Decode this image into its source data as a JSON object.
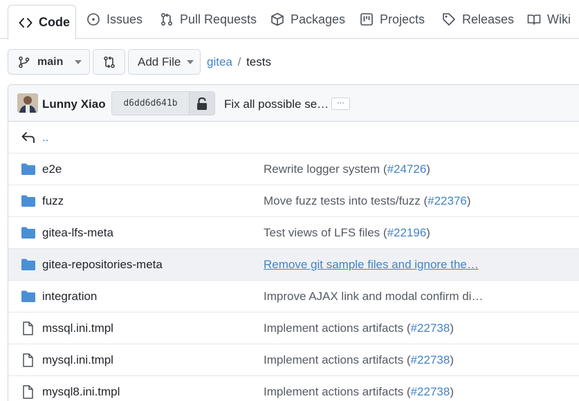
{
  "tabs": [
    {
      "label": "Code",
      "icon": "code-icon",
      "active": true
    },
    {
      "label": "Issues",
      "icon": "issue-icon"
    },
    {
      "label": "Pull Requests",
      "icon": "pull-request-icon"
    },
    {
      "label": "Packages",
      "icon": "package-icon"
    },
    {
      "label": "Projects",
      "icon": "project-icon"
    },
    {
      "label": "Releases",
      "icon": "tag-icon"
    },
    {
      "label": "Wiki",
      "icon": "book-icon"
    }
  ],
  "toolbar": {
    "branch": "main",
    "add_file": "Add File",
    "breadcrumb": {
      "repo": "gitea",
      "sep": "/",
      "path": "tests"
    }
  },
  "commit": {
    "author": "Lunny Xiao",
    "sha": "d6dd6d641b",
    "message": "Fix all possible se…",
    "ellipsis": "···"
  },
  "parent_dir": "..",
  "files": [
    {
      "name": "e2e",
      "type": "folder",
      "message": "Rewrite logger system (",
      "pr": "#24726",
      "tail": ")"
    },
    {
      "name": "fuzz",
      "type": "folder",
      "message": "Move fuzz tests into tests/fuzz (",
      "pr": "#22376",
      "tail": ")"
    },
    {
      "name": "gitea-lfs-meta",
      "type": "folder",
      "message": "Test views of LFS files (",
      "pr": "#22196",
      "tail": ")"
    },
    {
      "name": "gitea-repositories-meta",
      "type": "folder",
      "message": "Remove git sample files and ignore the…",
      "pr": "",
      "tail": "",
      "highlight": true
    },
    {
      "name": "integration",
      "type": "folder",
      "message": "Improve AJAX link and modal confirm di…",
      "pr": "",
      "tail": ""
    },
    {
      "name": "mssql.ini.tmpl",
      "type": "file",
      "message": "Implement actions artifacts (",
      "pr": "#22738",
      "tail": ")"
    },
    {
      "name": "mysql.ini.tmpl",
      "type": "file",
      "message": "Implement actions artifacts (",
      "pr": "#22738",
      "tail": ")"
    },
    {
      "name": "mysql8.ini.tmpl",
      "type": "file",
      "message": "Implement actions artifacts (",
      "pr": "#22738",
      "tail": ")"
    }
  ],
  "colors": {
    "folder": "#4a8fd6",
    "link": "#4183c4",
    "border": "#d0d7de"
  }
}
